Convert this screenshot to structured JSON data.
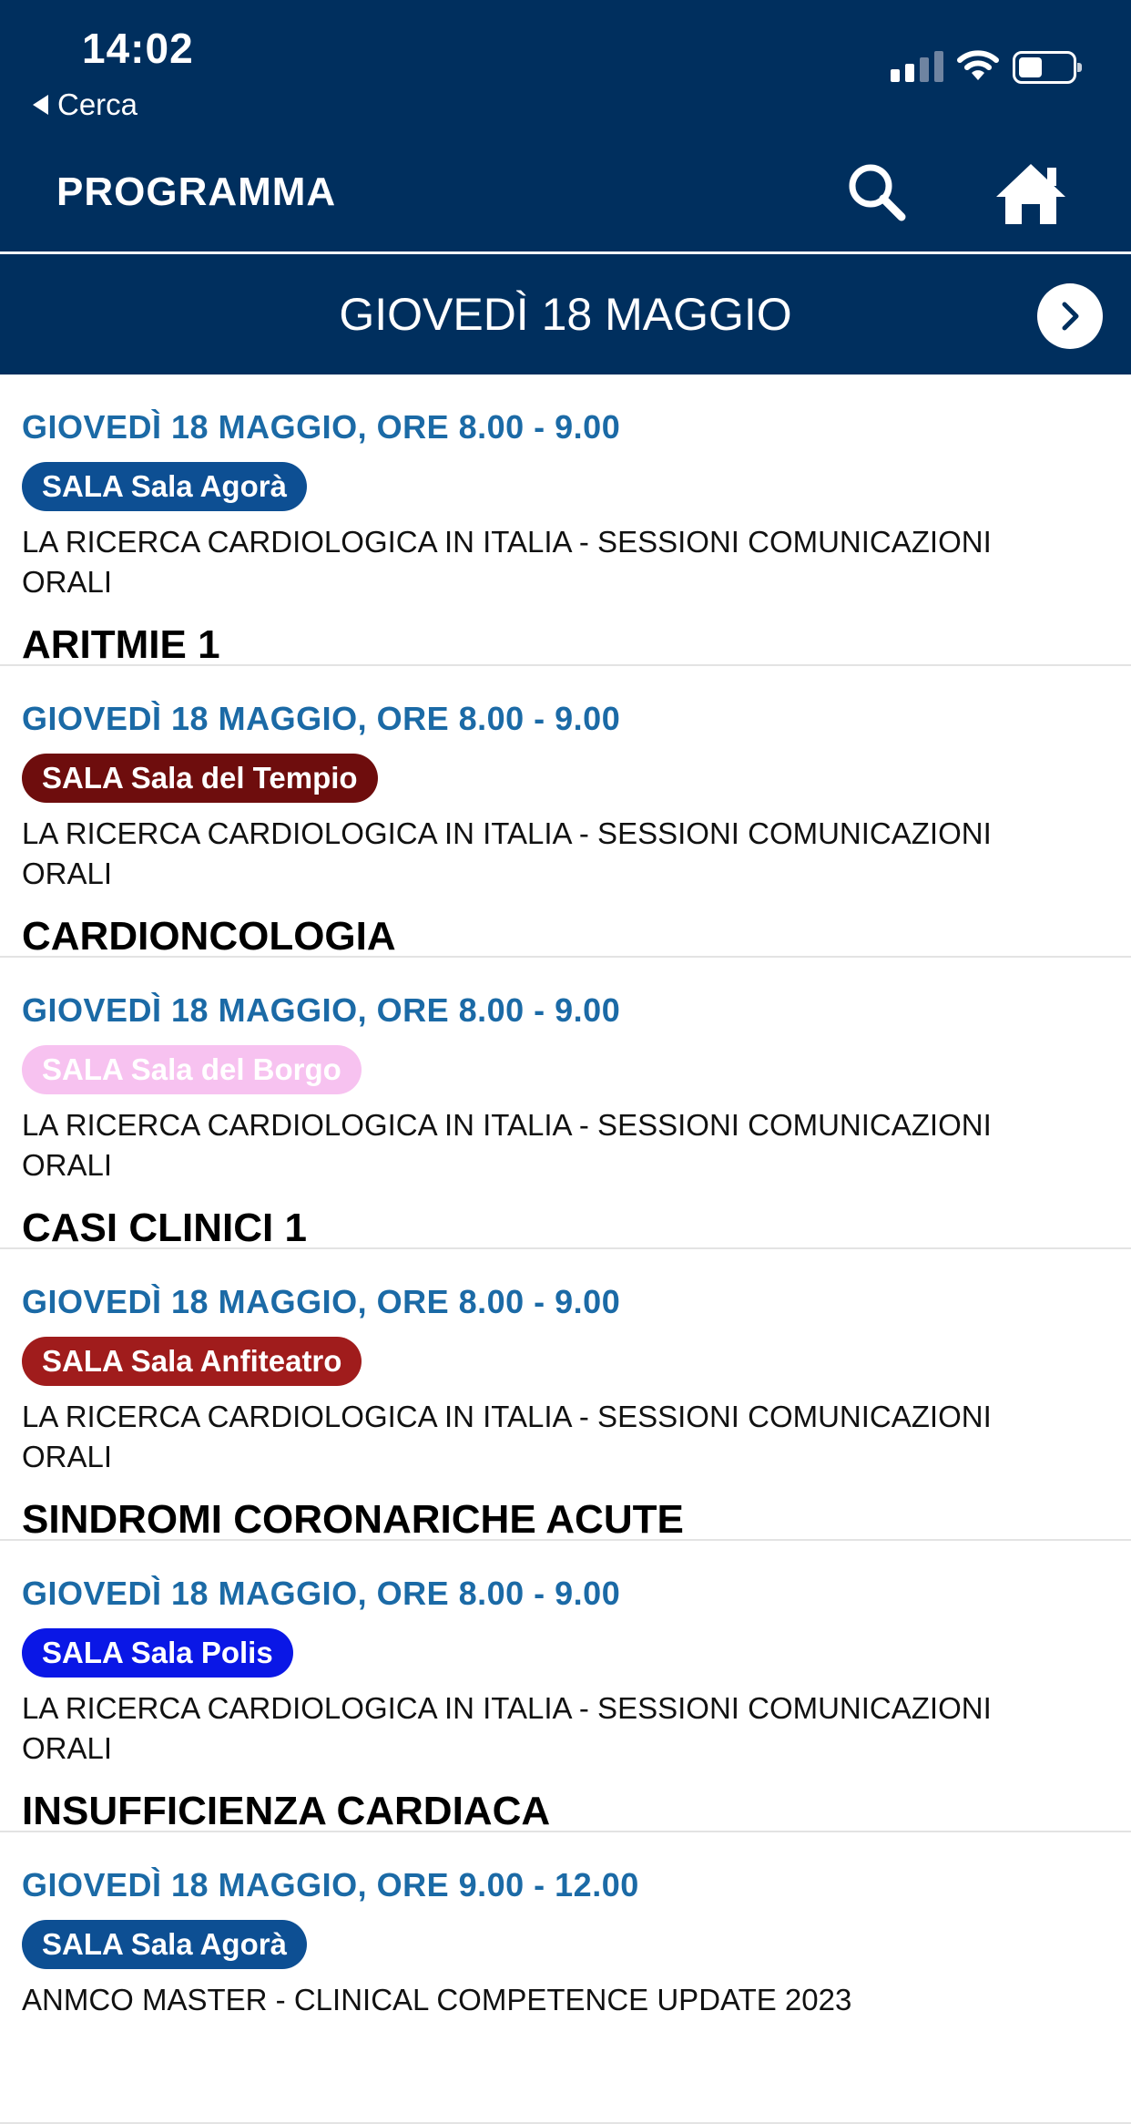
{
  "status_bar": {
    "time": "14:02",
    "back_label": "Cerca"
  },
  "nav": {
    "title": "PROGRAMMA",
    "search_icon": "search-icon",
    "home_icon": "home-icon"
  },
  "date_bar": {
    "label": "GIOVEDÌ 18 MAGGIO",
    "next_icon": "chevron-right-icon"
  },
  "colors": {
    "header_bg": "#002f5e",
    "time_text": "#1b6aa6"
  },
  "sessions": [
    {
      "time": "GIOVEDÌ 18 MAGGIO, ORE 8.00 - 9.00",
      "room": "SALA Sala Agorà",
      "room_color": "#0d4f93",
      "category": "LA RICERCA CARDIOLOGICA IN ITALIA - SESSIONI COMUNICAZIONI ORALI",
      "title": "ARITMIE 1"
    },
    {
      "time": "GIOVEDÌ 18 MAGGIO, ORE 8.00 - 9.00",
      "room": "SALA Sala del Tempio",
      "room_color": "#6e0d0d",
      "category": "LA RICERCA CARDIOLOGICA IN ITALIA - SESSIONI COMUNICAZIONI ORALI",
      "title": "CARDIONCOLOGIA"
    },
    {
      "time": "GIOVEDÌ 18 MAGGIO, ORE 8.00 - 9.00",
      "room": "SALA Sala del Borgo",
      "room_color": "#f7c2f0",
      "category": "LA RICERCA CARDIOLOGICA IN ITALIA - SESSIONI COMUNICAZIONI ORALI",
      "title": "CASI CLINICI 1"
    },
    {
      "time": "GIOVEDÌ 18 MAGGIO, ORE 8.00 - 9.00",
      "room": "SALA Sala Anfiteatro",
      "room_color": "#a01c1c",
      "category": "LA RICERCA CARDIOLOGICA IN ITALIA - SESSIONI COMUNICAZIONI ORALI",
      "title": "SINDROMI CORONARICHE ACUTE"
    },
    {
      "time": "GIOVEDÌ 18 MAGGIO, ORE 8.00 - 9.00",
      "room": "SALA Sala Polis",
      "room_color": "#0a17e6",
      "category": "LA RICERCA CARDIOLOGICA IN ITALIA - SESSIONI COMUNICAZIONI ORALI",
      "title": "INSUFFICIENZA CARDIACA"
    },
    {
      "time": "GIOVEDÌ 18 MAGGIO, ORE 9.00 - 12.00",
      "room": "SALA Sala Agorà",
      "room_color": "#0d4f93",
      "category": "ANMCO MASTER - CLINICAL COMPETENCE UPDATE 2023",
      "title": ""
    }
  ]
}
